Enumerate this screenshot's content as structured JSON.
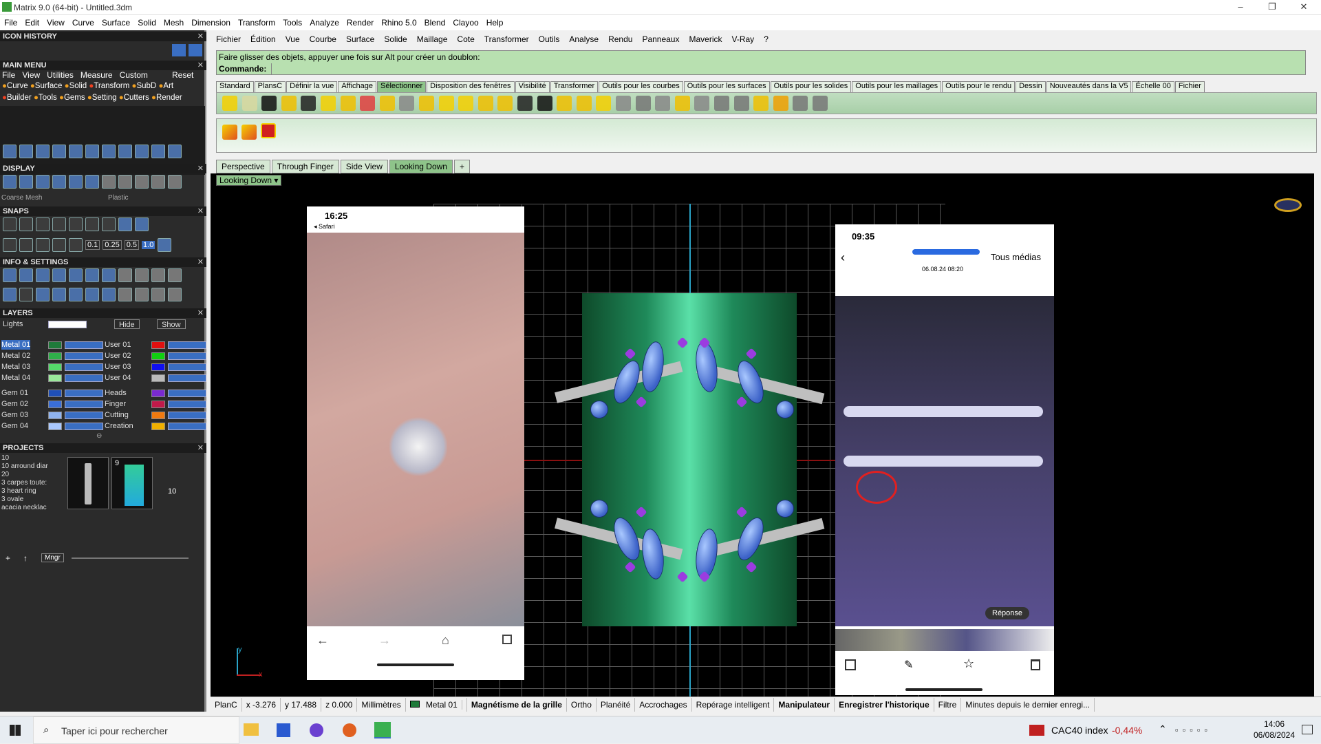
{
  "window": {
    "title": "Matrix 9.0 (64-bit) - Untitled.3dm"
  },
  "menubar": [
    "File",
    "Edit",
    "View",
    "Curve",
    "Surface",
    "Solid",
    "Mesh",
    "Dimension",
    "Transform",
    "Tools",
    "Analyze",
    "Render",
    "Rhino 5.0",
    "Blend",
    "Clayoo",
    "Help"
  ],
  "left": {
    "icon_history": "ICON HISTORY",
    "main_menu": "MAIN MENU",
    "main_menu_row": [
      "File",
      "View",
      "Utilities",
      "Measure",
      "Custom",
      "Reset"
    ],
    "category_row1": [
      "Curve",
      "Surface",
      "Solid",
      "Transform",
      "SubD",
      "Art"
    ],
    "category_row2": [
      "Builder",
      "Tools",
      "Gems",
      "Setting",
      "Cutters",
      "Render"
    ],
    "display": "DISPLAY",
    "display_mesh": "Coarse Mesh",
    "display_material": "Plastic",
    "snaps": "SNAPS",
    "snap_values": [
      "0.1",
      "0.25",
      "0.5",
      "1.0"
    ],
    "info_settings": "INFO & SETTINGS",
    "layers_title": "LAYERS",
    "lights": "Lights",
    "hide": "Hide",
    "show": "Show",
    "layers_left": [
      "Metal 01",
      "Metal 02",
      "Metal 03",
      "Metal 04",
      "Gem 01",
      "Gem 02",
      "Gem 03",
      "Gem 04"
    ],
    "layers_left_colors": [
      "#1f7a3a",
      "#2fb04a",
      "#55d86a",
      "#9ae89a",
      "#1f4fb8",
      "#3a6ed8",
      "#8fb3f0",
      "#a9c8ff"
    ],
    "layers_right": [
      "User 01",
      "User 02",
      "User 03",
      "User 04",
      "Heads",
      "Finger",
      "Cutting",
      "Creation"
    ],
    "layers_right_colors": [
      "#e01010",
      "#10d010",
      "#1010f0",
      "#bbbbbb",
      "#7a2ad0",
      "#c01a4a",
      "#f07a10",
      "#f0b000"
    ],
    "projects": "PROJECTS",
    "project_list": [
      "10",
      "10 arround diar",
      "20",
      "3 carpes toute:",
      "3 heart ring",
      "3 ovale",
      "acacia necklac"
    ],
    "thumb_numbers": [
      "9",
      "10"
    ],
    "mngr": "Mngr"
  },
  "right_menu": [
    "Fichier",
    "Édition",
    "Vue",
    "Courbe",
    "Surface",
    "Solide",
    "Maillage",
    "Cote",
    "Transformer",
    "Outils",
    "Analyse",
    "Rendu",
    "Panneaux",
    "Maverick",
    "V-Ray",
    "?"
  ],
  "command": {
    "hint": "Faire glisser des objets, appuyer une fois sur Alt pour créer un doublon:",
    "prompt": "Commande:"
  },
  "tabs": [
    "Standard",
    "PlansC",
    "Définir la vue",
    "Affichage",
    "Sélectionner",
    "Disposition des fenêtres",
    "Visibilité",
    "Transformer",
    "Outils pour les courbes",
    "Outils pour les surfaces",
    "Outils pour les solides",
    "Outils pour les maillages",
    "Outils pour le rendu",
    "Dessin",
    "Nouveautés dans la V5",
    "Échelle 00",
    "Fichier"
  ],
  "selected_tab": "Sélectionner",
  "viewport_tabs": [
    "Perspective",
    "Through Finger",
    "Side View",
    "Looking Down"
  ],
  "active_view": "Looking Down",
  "phone_left": {
    "time": "16:25",
    "back": "◂ Safari"
  },
  "phone_right": {
    "time": "09:35",
    "date": "06.08.24 08:20",
    "all_media": "Tous médias",
    "reply": "Réponse"
  },
  "axis": {
    "x": "x",
    "y": "y"
  },
  "status": {
    "plane": "PlanC",
    "x": "x -3.276",
    "y": "y 17.488",
    "z": "z 0.000",
    "units": "Millimètres",
    "layer": "Metal 01",
    "grid_snap": "Magnétisme de la grille",
    "ortho": "Ortho",
    "planar": "Planéité",
    "osnap": "Accrochages",
    "smarttrack": "Repérage intelligent",
    "gumball": "Manipulateur",
    "history": "Enregistrer l'historique",
    "filter": "Filtre",
    "minutes": "Minutes depuis le dernier enregi..."
  },
  "taskbar": {
    "search": "Taper ici pour rechercher",
    "stock_name": "CAC40 index",
    "stock_change": "-0,44%",
    "time": "14:06",
    "date": "06/08/2024"
  }
}
